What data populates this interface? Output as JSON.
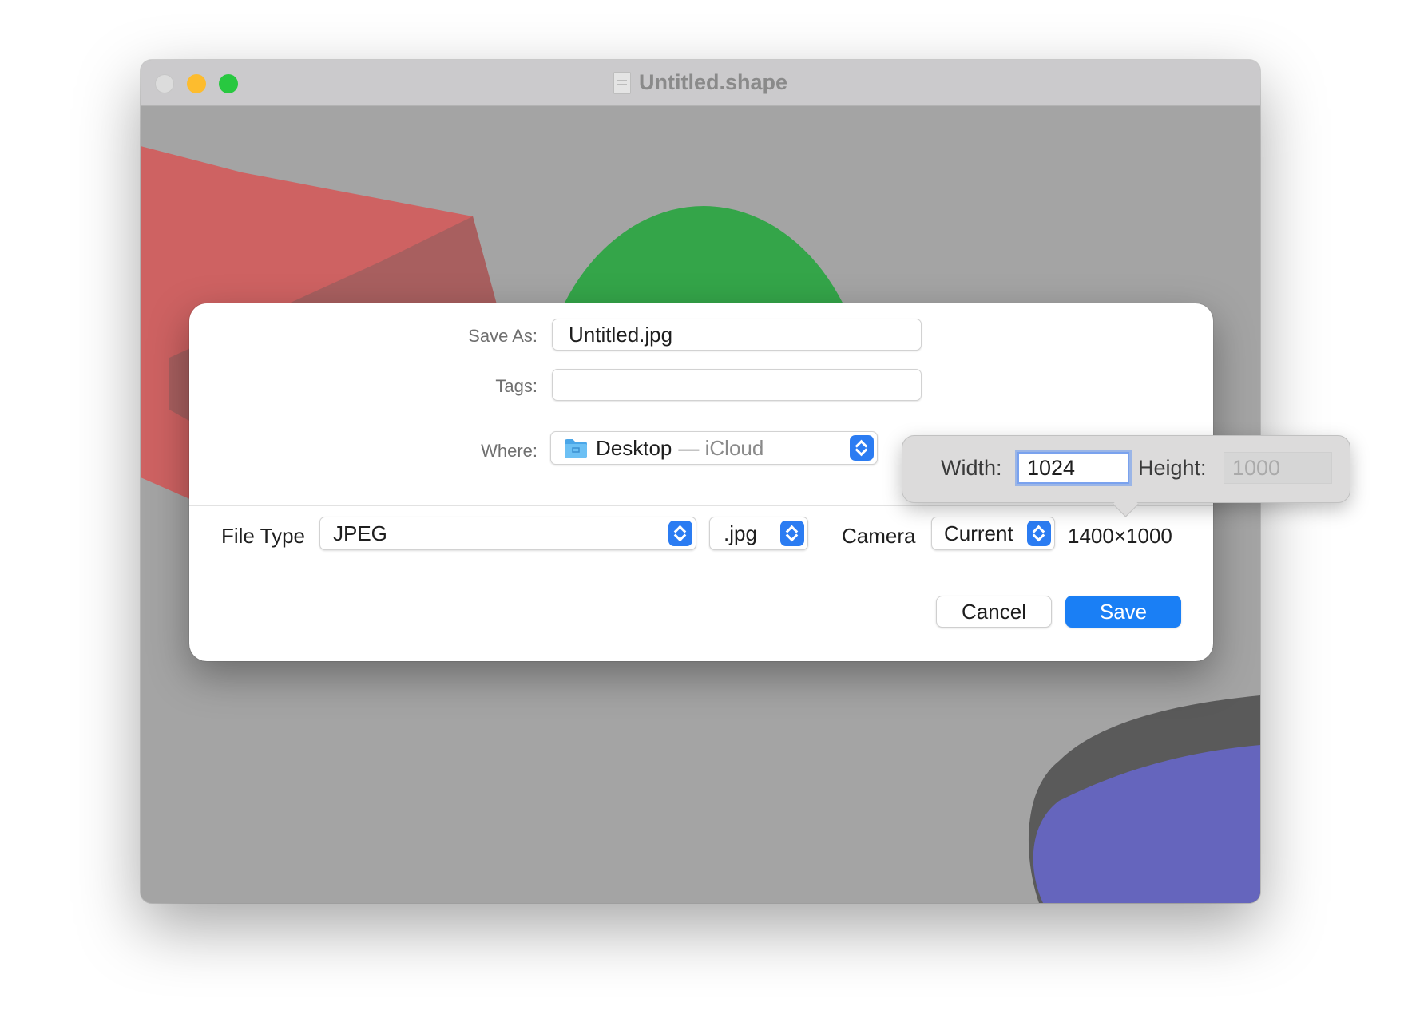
{
  "window": {
    "title": "Untitled.shape",
    "traffic_lights": [
      "close",
      "minimize",
      "zoom"
    ]
  },
  "save_dialog": {
    "save_as_label": "Save As:",
    "save_as_value": "Untitled.jpg",
    "tags_label": "Tags:",
    "tags_value": "",
    "where_label": "Where:",
    "where_location": "Desktop",
    "where_detail": "— iCloud",
    "where_icon": "folder-icon",
    "file_type_label": "File Type",
    "file_type_value": "JPEG",
    "extension_value": ".jpg",
    "camera_label": "Camera",
    "camera_value": "Current",
    "dimensions_value": "1400×1000",
    "cancel_label": "Cancel",
    "save_label": "Save"
  },
  "size_popover": {
    "width_label": "Width:",
    "width_value": "1024",
    "height_label": "Height:",
    "height_value": "1000"
  },
  "colors": {
    "accent": "#1a7ff5",
    "canvas_bg": "#a4a4a4",
    "shape_red": "#ce6262",
    "shape_green": "#34a549",
    "shape_blue": "#6565bd"
  }
}
